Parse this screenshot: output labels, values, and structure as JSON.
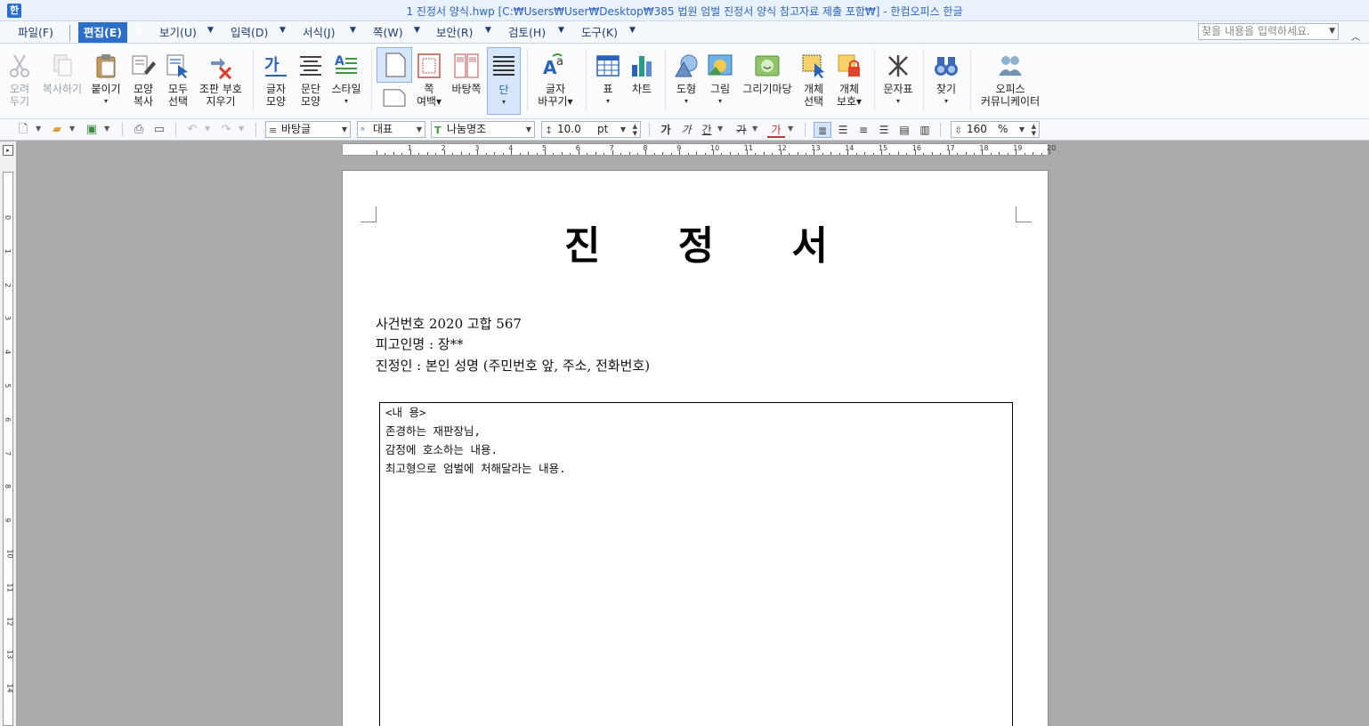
{
  "window": {
    "title": "1 진정서 양식.hwp [C:₩Users₩User₩Desktop₩385 법원 엄벌 진정서 양식 참고자료 제출 포함₩] - 한컴오피스 한글",
    "app_icon": "hwp-app-icon"
  },
  "menu": {
    "items": [
      {
        "label": "파일(F)"
      },
      {
        "label": "편집(E)"
      },
      {
        "label": "보기(U)"
      },
      {
        "label": "입력(D)"
      },
      {
        "label": "서식(J)"
      },
      {
        "label": "쪽(W)"
      },
      {
        "label": "보안(R)"
      },
      {
        "label": "검토(H)"
      },
      {
        "label": "도구(K)"
      }
    ],
    "active_index": 1,
    "search_placeholder": "찾을 내용을 입력하세요."
  },
  "ribbon": {
    "buttons": [
      {
        "line1": "오려",
        "line2": "두기",
        "icon": "scissors-icon"
      },
      {
        "line1": "복사하기",
        "line2": "",
        "icon": "copy-icon"
      },
      {
        "line1": "붙이기",
        "line2": "▾",
        "icon": "clipboard-icon"
      },
      {
        "line1": "모양",
        "line2": "복사",
        "icon": "format-painter-icon"
      },
      {
        "line1": "모두",
        "line2": "선택",
        "icon": "select-all-icon"
      },
      {
        "line1": "조판 부호",
        "line2": "지우기",
        "icon": "erase-marks-icon"
      },
      {
        "line1": "글자",
        "line2": "모양",
        "icon": "char-shape-icon"
      },
      {
        "line1": "문단",
        "line2": "모양",
        "icon": "paragraph-shape-icon"
      },
      {
        "line1": "스타일",
        "line2": "▾",
        "icon": "style-icon"
      },
      {
        "line1": "",
        "line2": "",
        "icon": "page-icon"
      },
      {
        "line1": "쪽",
        "line2": "여백▾",
        "icon": "page-margin-icon"
      },
      {
        "line1": "바탕쪽",
        "line2": "",
        "icon": "master-page-icon"
      },
      {
        "line1": "단",
        "line2": "▾",
        "icon": "columns-icon"
      },
      {
        "line1": "글자",
        "line2": "바꾸기▾",
        "icon": "replace-text-icon"
      },
      {
        "line1": "표",
        "line2": "▾",
        "icon": "table-icon"
      },
      {
        "line1": "차트",
        "line2": "",
        "icon": "chart-icon"
      },
      {
        "line1": "도형",
        "line2": "▾",
        "icon": "shape-icon"
      },
      {
        "line1": "그림",
        "line2": "▾",
        "icon": "picture-icon"
      },
      {
        "line1": "그리기마당",
        "line2": "",
        "icon": "clipart-icon"
      },
      {
        "line1": "개체",
        "line2": "선택",
        "icon": "object-select-icon"
      },
      {
        "line1": "개체",
        "line2": "보호▾",
        "icon": "object-protect-icon"
      },
      {
        "line1": "문자표",
        "line2": "▾",
        "icon": "symbol-icon"
      },
      {
        "line1": "찾기",
        "line2": "▾",
        "icon": "find-icon"
      },
      {
        "line1": "오피스",
        "line2": "커뮤니케이터",
        "icon": "communicator-icon"
      }
    ]
  },
  "format": {
    "style": "바탕글",
    "lang": "대표",
    "font": "나눔명조",
    "size": "10.0",
    "size_unit": "pt",
    "line_spacing": "160",
    "line_spacing_unit": "%",
    "bold": "가",
    "italic": "가",
    "underline": "간",
    "strike": "가",
    "color": "가"
  },
  "ruler": {
    "h_numbers": [
      "1",
      "2",
      "3",
      "4",
      "5",
      "6",
      "7",
      "8",
      "9",
      "10",
      "11",
      "12",
      "13",
      "14",
      "15",
      "16",
      "17",
      "18",
      "19",
      "20"
    ],
    "v_numbers": [
      "0",
      "1",
      "2",
      "3",
      "4",
      "5",
      "6",
      "7",
      "8",
      "9",
      "10",
      "11",
      "12",
      "13",
      "14"
    ]
  },
  "document": {
    "title": "진 정 서",
    "info": [
      "사건번호 2020 고합 567",
      "피고인명 : 장**",
      "진정인 : 본인 성명 (주민번호 앞, 주소, 전화번호)"
    ],
    "box_lines": [
      "<내    용>",
      "존경하는 재판장님,",
      "감정에 호소하는 내용.",
      "최고형으로 엄벌에 처해달라는 내용."
    ]
  },
  "colors": {
    "accent": "#2c6fc9",
    "title_text": "#2b64c6",
    "workspace": "#ababab"
  }
}
